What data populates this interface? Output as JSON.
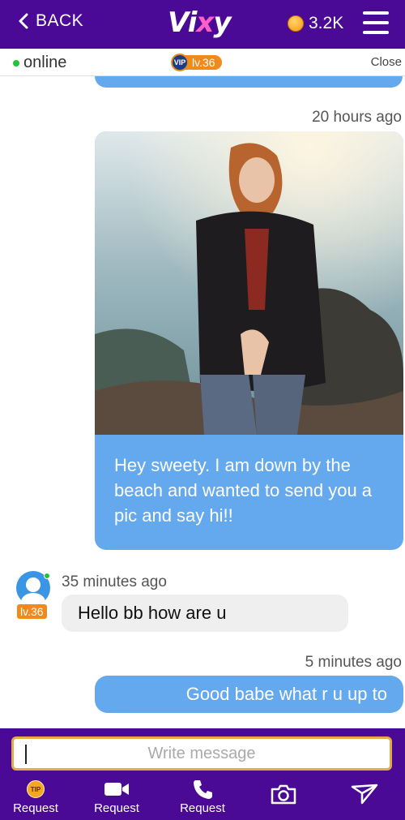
{
  "header": {
    "back_label": "BACK",
    "logo_pre": "Vi",
    "logo_x": "x",
    "logo_post": "y",
    "coins": "3.2K"
  },
  "status": {
    "online_label": "online",
    "vip_badge": "VIP",
    "vip_level": "lv.36",
    "close_label": "Close"
  },
  "messages": [
    {
      "time": "20 hours ago",
      "direction": "outgoing",
      "has_photo": true,
      "text": "Hey sweety. I am down by the beach and wanted to send you a pic and say hi!!"
    },
    {
      "time": "35 minutes ago",
      "direction": "incoming",
      "sender_level": "lv.36",
      "text": "Hello bb how are u"
    },
    {
      "time": "5 minutes ago",
      "direction": "outgoing",
      "text": "Good babe what r u up to"
    }
  ],
  "composer": {
    "placeholder": "Write message",
    "value": ""
  },
  "actions": [
    {
      "icon": "tip-icon",
      "tip_text": "TIP",
      "label": "Request"
    },
    {
      "icon": "video-camera-icon",
      "label": "Request"
    },
    {
      "icon": "phone-icon",
      "label": "Request"
    },
    {
      "icon": "camera-icon",
      "label": ""
    },
    {
      "icon": "send-icon",
      "label": ""
    }
  ],
  "colors": {
    "brand": "#4a0a96",
    "outgoing_bubble": "#64a8ee",
    "incoming_bubble": "#efefef",
    "accent": "#f08a1c",
    "online": "#22c33a"
  }
}
